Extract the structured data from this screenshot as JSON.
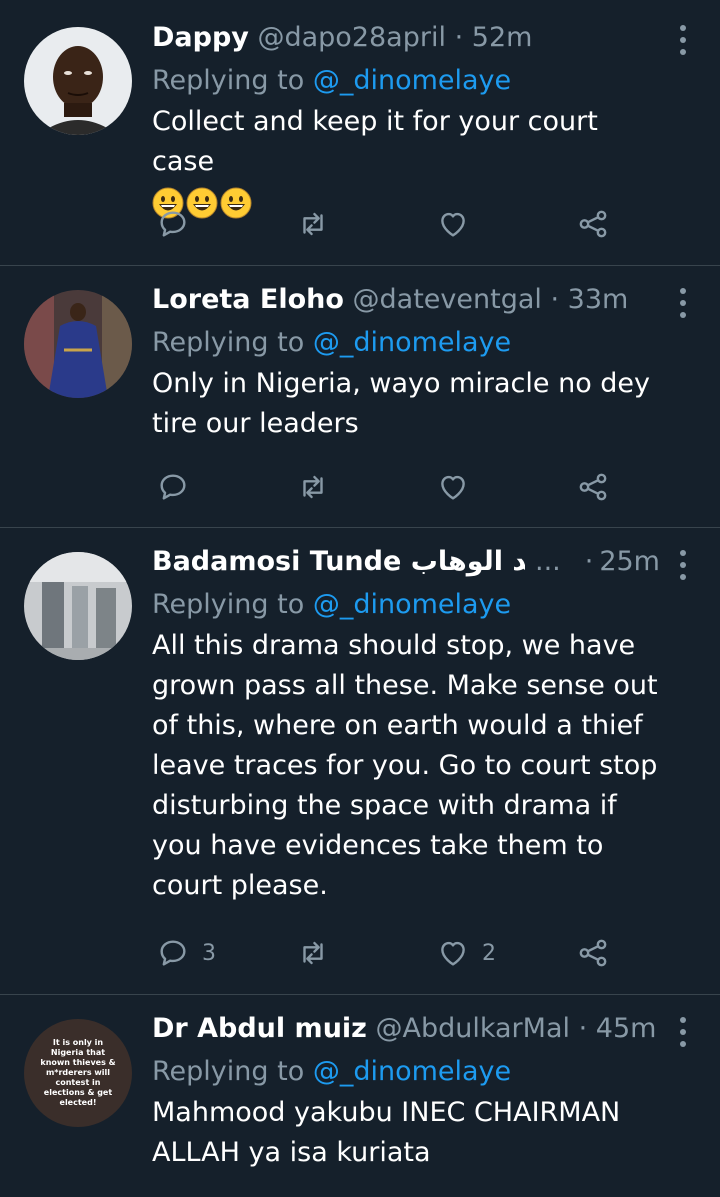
{
  "tweets": [
    {
      "name": "Dappy",
      "handle": "@dapo28april",
      "dot": "·",
      "time": "52m",
      "replying_prefix": "Replying to ",
      "mention": "@_dinomelaye",
      "text": "Collect and keep it for your court case",
      "emojis": [
        "grinning-face",
        "grinning-face",
        "grinning-face"
      ],
      "reply_count": "",
      "like_count": ""
    },
    {
      "name": "Loreta Eloho",
      "handle": "@dateventgal",
      "dot": "·",
      "time": "33m",
      "replying_prefix": "Replying to ",
      "mention": "@_dinomelaye",
      "text": "Only in Nigeria, wayo miracle no dey tire our leaders",
      "reply_count": "",
      "like_count": ""
    },
    {
      "name": "Badamosi Tunde عبد الوهاب",
      "handle": "...",
      "dot": "·",
      "time": "25m",
      "replying_prefix": "Replying to ",
      "mention": "@_dinomelaye",
      "text": "All this drama should stop, we have grown pass all these. Make sense out of this, where on earth would a thief leave traces for you. Go to court stop disturbing the space with drama if you have evidences take them to court please.",
      "reply_count": "3",
      "like_count": "2"
    },
    {
      "name": "Dr Abdul muiz",
      "handle": "@AbdulkarMal",
      "dot": "·",
      "time": "45m",
      "replying_prefix": "Replying to ",
      "mention": "@_dinomelaye",
      "text": "Mahmood yakubu INEC CHAIRMAN ALLAH ya isa kuriata",
      "avatar_text": "It is only in Nigeria that known thieves & m*rderers will contest in elections & get elected!"
    }
  ],
  "colors": {
    "background": "#15202b",
    "secondary_text": "#8899a6",
    "mention": "#1d9bf0",
    "divider": "#38444d"
  }
}
